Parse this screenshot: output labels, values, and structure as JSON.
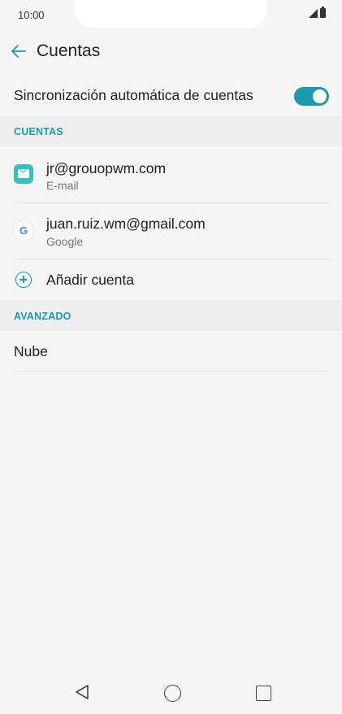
{
  "status_bar": {
    "time": "10:00"
  },
  "app_bar": {
    "title": "Cuentas"
  },
  "sync": {
    "label": "Sincronización automática de cuentas",
    "enabled": true
  },
  "sections": {
    "accounts_header": "CUENTAS",
    "advanced_header": "AVANZADO"
  },
  "accounts": [
    {
      "title": "jr@grouopwm.com",
      "subtitle": "E-mail",
      "icon": "email-icon"
    },
    {
      "title": "juan.ruiz.wm@gmail.com",
      "subtitle": "Google",
      "icon": "google-icon"
    }
  ],
  "add_account": {
    "label": "Añadir cuenta",
    "icon": "plus-icon"
  },
  "advanced": {
    "cloud_label": "Nube"
  },
  "colors": {
    "accent": "#1a9bae",
    "background": "#f5f5f5",
    "section_bg": "#efefef"
  }
}
